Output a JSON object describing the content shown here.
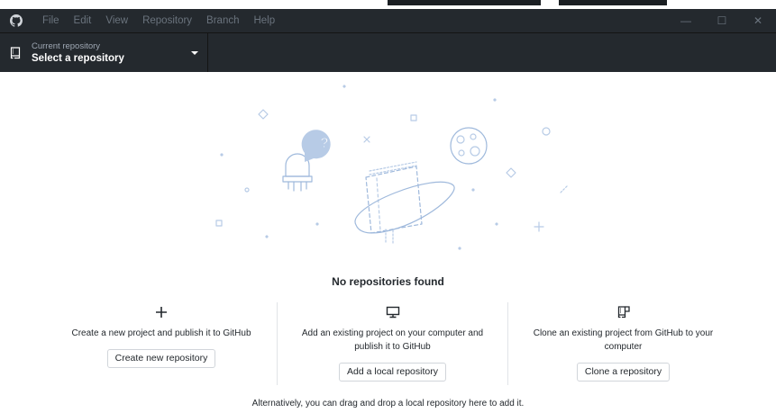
{
  "menu": [
    "File",
    "Edit",
    "View",
    "Repository",
    "Branch",
    "Help"
  ],
  "window_controls": {
    "minimize": "—",
    "maximize": "☐",
    "close": "✕"
  },
  "repo_selector": {
    "caption": "Current repository",
    "value": "Select a repository"
  },
  "blank_slate": {
    "headline": "No repositories found",
    "actions": [
      {
        "icon": "plus-icon",
        "description": "Create a new project and publish it to GitHub",
        "button": "Create new repository"
      },
      {
        "icon": "desktop-icon",
        "description": "Add an existing project on your computer and publish it to GitHub",
        "button": "Add a local repository"
      },
      {
        "icon": "repo-clone-icon",
        "description": "Clone an existing project from GitHub to your computer",
        "button": "Clone a repository"
      }
    ],
    "footer": "Alternatively, you can drag and drop a local repository here to add it."
  },
  "colors": {
    "titlebar": "#24292e",
    "illustration": "#c8d9ef",
    "accent": "#0366d6"
  }
}
